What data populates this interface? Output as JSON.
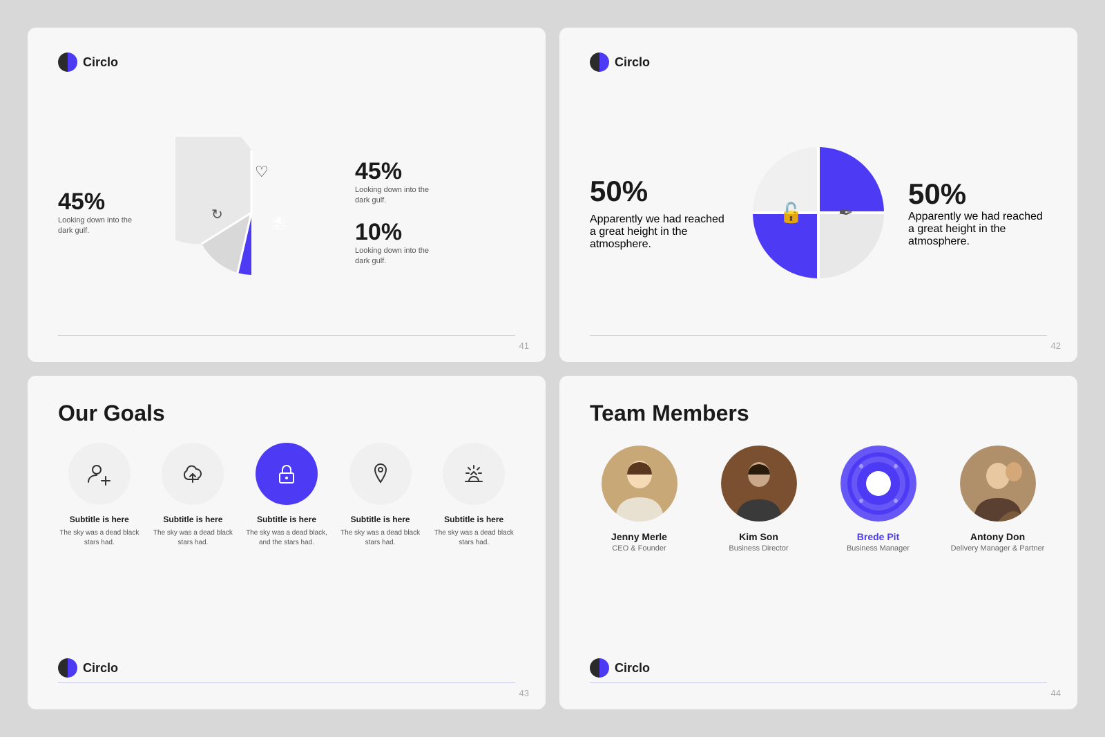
{
  "slide1": {
    "logo": "Circlo",
    "number": "41",
    "left_stat": {
      "pct": "45%",
      "desc": "Looking down into the dark gulf."
    },
    "stats": [
      {
        "pct": "45%",
        "desc": "Looking down into the dark gulf."
      },
      {
        "pct": "10%",
        "desc": "Looking down into the dark gulf."
      }
    ],
    "chart": {
      "segments": [
        {
          "label": "heart",
          "color": "#e8e8e8",
          "value": 45
        },
        {
          "label": "refresh",
          "color": "#d0d0d0",
          "value": 45
        },
        {
          "label": "umbrella",
          "color": "#4d3af5",
          "value": 10
        }
      ]
    }
  },
  "slide2": {
    "logo": "Circlo",
    "number": "42",
    "left": {
      "pct": "50%",
      "desc": "Apparently we had reached a great height in the atmosphere."
    },
    "right": {
      "pct": "50%",
      "desc": "Apparently we had reached a great height in the atmosphere."
    }
  },
  "slide3": {
    "title": "Our Goals",
    "logo": "Circlo",
    "number": "43",
    "goals": [
      {
        "icon": "👤+",
        "subtitle": "Subtitle is here",
        "desc": "The sky was a dead black stars had.",
        "active": false
      },
      {
        "icon": "☁↑",
        "subtitle": "Subtitle is here",
        "desc": "The sky was a dead black stars had.",
        "active": false
      },
      {
        "icon": "🔒",
        "subtitle": "Subtitle is here",
        "desc": "The sky was a dead black, and the stars had.",
        "active": true
      },
      {
        "icon": "📍",
        "subtitle": "Subtitle is here",
        "desc": "The sky was a dead black stars had.",
        "active": false
      },
      {
        "icon": "🌅",
        "subtitle": "Subtitle is here",
        "desc": "The sky was a dead black stars had.",
        "active": false
      }
    ]
  },
  "slide4": {
    "title": "Team Members",
    "logo": "Circlo",
    "number": "44",
    "members": [
      {
        "name": "Jenny Merle",
        "role": "CEO & Founder",
        "highlight": false
      },
      {
        "name": "Kim Son",
        "role": "Business Director",
        "highlight": false
      },
      {
        "name": "Brede Pit",
        "role": "Business Manager",
        "highlight": true
      },
      {
        "name": "Antony Don",
        "role": "Delivery Manager & Partner",
        "highlight": false
      }
    ]
  }
}
